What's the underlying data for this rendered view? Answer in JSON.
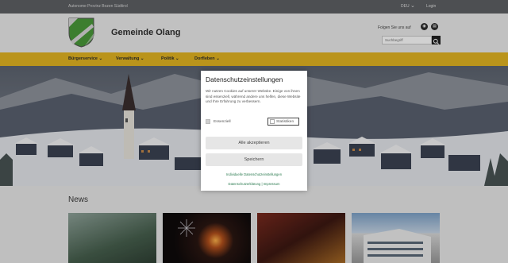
{
  "topbar": {
    "province": "Autonome Provinz Bozen Südtirol",
    "language": "DEU",
    "login": "Login"
  },
  "header": {
    "site_name": "Gemeinde Olang",
    "follow_label": "Folgen Sie uns auf",
    "search_placeholder": "Suchbegriff"
  },
  "nav": {
    "items": [
      "Bürgerservice",
      "Verwaltung",
      "Politik",
      "Dorfleben"
    ]
  },
  "news": {
    "title": "News"
  },
  "cookie_modal": {
    "title": "Datenschutzeinstellungen",
    "description": "Wir nutzen Cookies auf unserer Website. Einige von ihnen sind essenziell, während andere uns helfen, diese Website und Ihre Erfahrung zu verbessern.",
    "options": [
      {
        "label": "Essenziell",
        "checked": true,
        "disabled": true
      },
      {
        "label": "Statistiken",
        "checked": false,
        "disabled": false
      }
    ],
    "accept_all_label": "Alle akzeptieren",
    "save_label": "Speichern",
    "individual_link": "Individuelle Datenschutzeinstellungen",
    "privacy_link": "Datenschutzerklärung",
    "imprint_link": "Impressum",
    "link_separator": "|"
  },
  "colors": {
    "nav_accent": "#e3b521",
    "topbar": "#5e6165",
    "link": "#2a7a4f"
  },
  "icons": [
    "crest-logo",
    "rss-icon",
    "social-icon",
    "search-icon",
    "chevron-down-icon"
  ]
}
